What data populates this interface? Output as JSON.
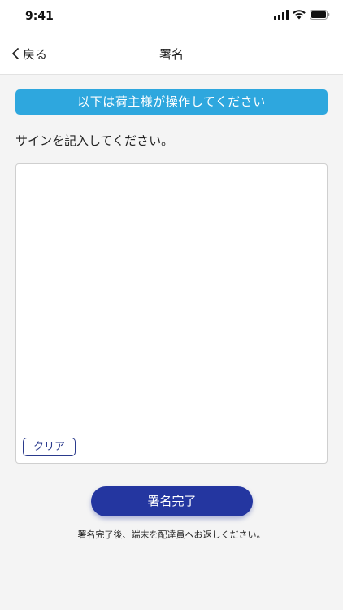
{
  "status_bar": {
    "time": "9:41"
  },
  "nav": {
    "back_label": "戻る",
    "title": "署名"
  },
  "banner": {
    "text": "以下は荷主様が操作してください"
  },
  "instruction": "サインを記入してください。",
  "signature_pad": {
    "clear_label": "クリア"
  },
  "complete_button": {
    "label": "署名完了"
  },
  "footer_note": "署名完了後、端末を配達員へお返しください。",
  "colors": {
    "banner": "#2ea7de",
    "primary": "#2436a0",
    "clear_border": "#2a3a8c",
    "background": "#f4f4f4"
  }
}
